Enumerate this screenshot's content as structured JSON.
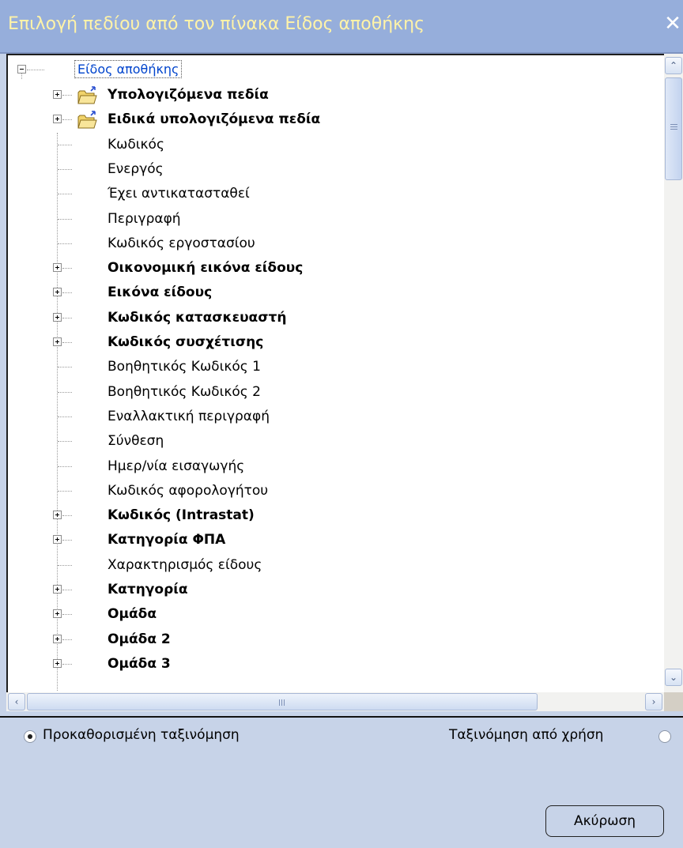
{
  "window": {
    "title": "Επιλογή πεδίου από τον πίνακα Είδος αποθήκης",
    "close_glyph": "✕"
  },
  "tree": {
    "root_label": "Είδος αποθήκης",
    "items": [
      {
        "label": "Υπολογιζόμενα πεδία",
        "bold": true,
        "expandable": true,
        "icon": "folder-icon"
      },
      {
        "label": "Ειδικά υπολογιζόμενα πεδία",
        "bold": true,
        "expandable": true,
        "icon": "folder-icon"
      },
      {
        "label": "Κωδικός",
        "bold": false,
        "expandable": false
      },
      {
        "label": "Ενεργός",
        "bold": false,
        "expandable": false
      },
      {
        "label": "Έχει αντικατασταθεί",
        "bold": false,
        "expandable": false
      },
      {
        "label": "Περιγραφή",
        "bold": false,
        "expandable": false
      },
      {
        "label": "Κωδικός εργοστασίου",
        "bold": false,
        "expandable": false
      },
      {
        "label": "Οικονομική εικόνα είδους",
        "bold": true,
        "expandable": true
      },
      {
        "label": "Εικόνα είδους",
        "bold": true,
        "expandable": true
      },
      {
        "label": "Κωδικός κατασκευαστή",
        "bold": true,
        "expandable": true
      },
      {
        "label": "Κωδικός συσχέτισης",
        "bold": true,
        "expandable": true
      },
      {
        "label": "Βοηθητικός Κωδικός 1",
        "bold": false,
        "expandable": false
      },
      {
        "label": "Βοηθητικός Κωδικός 2",
        "bold": false,
        "expandable": false
      },
      {
        "label": "Εναλλακτική περιγραφή",
        "bold": false,
        "expandable": false
      },
      {
        "label": "Σύνθεση",
        "bold": false,
        "expandable": false
      },
      {
        "label": "Ημερ/νία εισαγωγής",
        "bold": false,
        "expandable": false
      },
      {
        "label": "Κωδικός αφορολογήτου",
        "bold": false,
        "expandable": false
      },
      {
        "label": "Κωδικός (Intrastat)",
        "bold": true,
        "expandable": true
      },
      {
        "label": "Κατηγορία ΦΠΑ",
        "bold": true,
        "expandable": true
      },
      {
        "label": "Χαρακτηρισμός είδους",
        "bold": false,
        "expandable": false
      },
      {
        "label": "Κατηγορία",
        "bold": true,
        "expandable": true
      },
      {
        "label": "Ομάδα",
        "bold": true,
        "expandable": true
      },
      {
        "label": "Ομάδα 2",
        "bold": true,
        "expandable": true
      },
      {
        "label": "Ομάδα 3",
        "bold": true,
        "expandable": true
      }
    ]
  },
  "scrollbars": {
    "up_glyph": "⌃",
    "down_glyph": "⌄",
    "left_glyph": "‹",
    "right_glyph": "›"
  },
  "sorting": {
    "default_label": "Προκαθορισμένη ταξινόμηση",
    "default_checked": true,
    "usage_label": "Ταξινόμηση από χρήση",
    "usage_checked": false
  },
  "buttons": {
    "cancel_label": "Ακύρωση"
  }
}
